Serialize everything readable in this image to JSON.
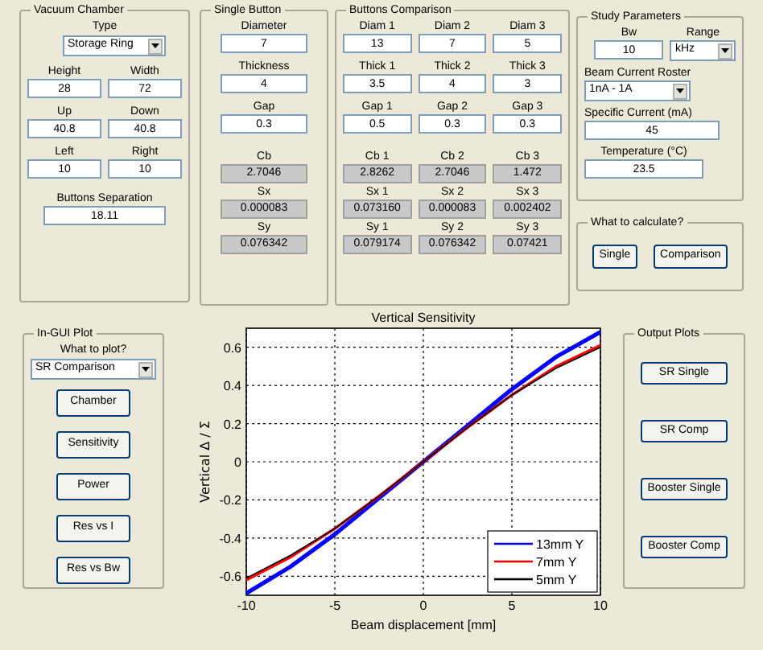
{
  "vacuum_chamber": {
    "title": "Vacuum Chamber",
    "type_label": "Type",
    "type_value": "Storage Ring",
    "fields": [
      {
        "label": "Height",
        "value": "28"
      },
      {
        "label": "Width",
        "value": "72"
      },
      {
        "label": "Up",
        "value": "40.8"
      },
      {
        "label": "Down",
        "value": "40.8"
      },
      {
        "label": "Left",
        "value": "10"
      },
      {
        "label": "Right",
        "value": "10"
      }
    ],
    "separation": {
      "label": "Buttons Separation",
      "value": "18.11"
    }
  },
  "single_button": {
    "title": "Single Button",
    "fields": [
      {
        "label": "Diameter",
        "value": "7"
      },
      {
        "label": "Thickness",
        "value": "4"
      },
      {
        "label": "Gap",
        "value": "0.3"
      }
    ],
    "results": [
      {
        "label": "Cb",
        "value": "2.7046"
      },
      {
        "label": "Sx",
        "value": "0.000083"
      },
      {
        "label": "Sy",
        "value": "0.076342"
      }
    ]
  },
  "buttons_comparison": {
    "title": "Buttons Comparison",
    "fields": [
      {
        "label": "Diam 1",
        "value": "13"
      },
      {
        "label": "Diam 2",
        "value": "7"
      },
      {
        "label": "Diam 3",
        "value": "5"
      },
      {
        "label": "Thick 1",
        "value": "3.5"
      },
      {
        "label": "Thick 2",
        "value": "4"
      },
      {
        "label": "Thick 3",
        "value": "3"
      },
      {
        "label": "Gap 1",
        "value": "0.5"
      },
      {
        "label": "Gap 2",
        "value": "0.3"
      },
      {
        "label": "Gap 3",
        "value": "0.3"
      }
    ],
    "results": [
      {
        "label": "Cb 1",
        "value": "2.8262"
      },
      {
        "label": "Cb 2",
        "value": "2.7046"
      },
      {
        "label": "Cb 3",
        "value": "1.472"
      },
      {
        "label": "Sx 1",
        "value": "0.073160"
      },
      {
        "label": "Sx 2",
        "value": "0.000083"
      },
      {
        "label": "Sx 3",
        "value": "0.002402"
      },
      {
        "label": "Sy 1",
        "value": "0.079174"
      },
      {
        "label": "Sy 2",
        "value": "0.076342"
      },
      {
        "label": "Sy 3",
        "value": "0.07421"
      }
    ]
  },
  "study_parameters": {
    "title": "Study Parameters",
    "bw": {
      "label": "Bw",
      "value": "10"
    },
    "range": {
      "label": "Range",
      "value": "kHz"
    },
    "roster": {
      "label": "Beam Current Roster",
      "value": "1nA - 1A"
    },
    "specific_current": {
      "label": "Specific Current (mA)",
      "value": "45"
    },
    "temperature": {
      "label": "Temperature (°C)",
      "value": "23.5"
    }
  },
  "what_to_calculate": {
    "title": "What to calculate?",
    "buttons": [
      "Single",
      "Comparison"
    ]
  },
  "in_gui_plot": {
    "title": "In-GUI Plot",
    "what_label": "What to plot?",
    "plot_value": "SR Comparison",
    "buttons": [
      "Chamber",
      "Sensitivity",
      "Power",
      "Res vs I",
      "Res vs Bw"
    ]
  },
  "plot": {
    "chart_data": {
      "type": "line",
      "title": "Vertical Sensitivity",
      "xlabel": "Beam displacement [mm]",
      "ylabel": "Vertical Δ / Σ",
      "grid": true,
      "legend": true,
      "x": [
        -10,
        -7.5,
        -5,
        -2.5,
        0,
        2.5,
        5,
        7.5,
        10
      ],
      "xlim": [
        -10,
        10
      ],
      "ylim": [
        -0.7,
        0.7
      ],
      "xticks": [
        -10,
        -5,
        0,
        5,
        10
      ],
      "yticks": [
        -0.6,
        -0.4,
        -0.2,
        0,
        0.2,
        0.4,
        0.6
      ],
      "series": [
        {
          "name": "13mm Y",
          "color": "#0000ff",
          "values": [
            -0.69,
            -0.55,
            -0.38,
            -0.19,
            0,
            0.19,
            0.38,
            0.55,
            0.68
          ]
        },
        {
          "name": "7mm Y",
          "color": "#ff0000",
          "values": [
            -0.62,
            -0.5,
            -0.35,
            -0.18,
            0,
            0.18,
            0.35,
            0.5,
            0.61
          ]
        },
        {
          "name": "5mm Y",
          "color": "#000000",
          "values": [
            -0.61,
            -0.49,
            -0.35,
            -0.18,
            0,
            0.18,
            0.35,
            0.49,
            0.6
          ]
        }
      ]
    }
  },
  "output_plots": {
    "title": "Output Plots",
    "buttons": [
      "SR Single",
      "SR Comp",
      "Booster Single",
      "Booster Comp"
    ]
  }
}
